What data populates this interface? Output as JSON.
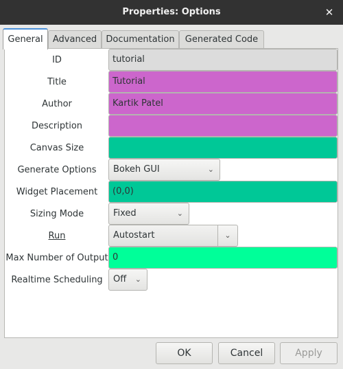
{
  "window": {
    "title": "Properties: Options",
    "close_glyph": "✕"
  },
  "tabs": [
    {
      "label": "General",
      "active": true
    },
    {
      "label": "Advanced",
      "active": false
    },
    {
      "label": "Documentation",
      "active": false
    },
    {
      "label": "Generated Code",
      "active": false
    }
  ],
  "form": {
    "id": {
      "label": "ID",
      "value": "tutorial"
    },
    "title": {
      "label": "Title",
      "value": "Tutorial"
    },
    "author": {
      "label": "Author",
      "value": "Kartik Patel"
    },
    "description": {
      "label": "Description",
      "value": ""
    },
    "canvas_size": {
      "label": "Canvas Size",
      "value": ""
    },
    "generate_options": {
      "label": "Generate Options",
      "value": "Bokeh GUI"
    },
    "widget_placement": {
      "label": "Widget Placement",
      "value": "(0,0)"
    },
    "sizing_mode": {
      "label": "Sizing Mode",
      "value": "Fixed"
    },
    "run": {
      "label": "Run",
      "value": "Autostart"
    },
    "max_outputs": {
      "label": "Max Number of Output",
      "value": "0"
    },
    "realtime_scheduling": {
      "label": "Realtime Scheduling",
      "value": "Off"
    }
  },
  "buttons": {
    "ok": "OK",
    "cancel": "Cancel",
    "apply": "Apply"
  },
  "colors": {
    "disabled_field": "#dcdcdc",
    "string_field": "#cc66cc",
    "int_vector_field": "#00c897",
    "int_field": "#00ff99",
    "titlebar": "#323232"
  },
  "icons": {
    "dropdown": "chevron-down-icon",
    "close": "close-icon"
  }
}
